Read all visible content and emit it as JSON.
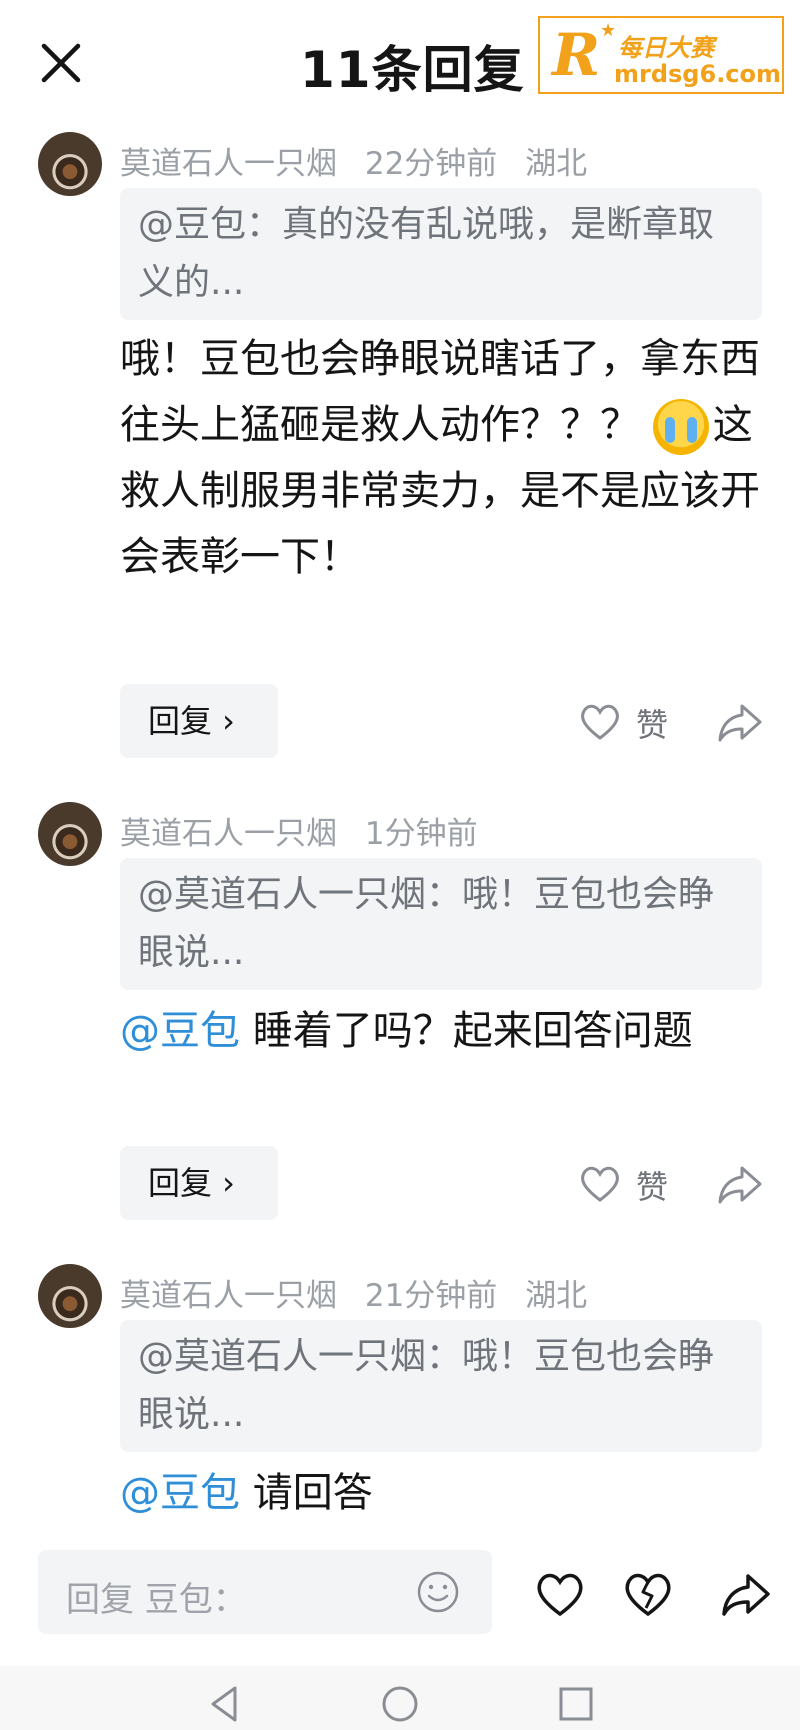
{
  "header": {
    "title": "11条回复",
    "watermark": {
      "letter": "R",
      "star": "★",
      "cn": "每日大赛",
      "url": "mrdsg6.com"
    }
  },
  "comments": [
    {
      "author": "莫道石人一只烟",
      "time": "22分钟前",
      "location": "湖北",
      "quote": "@豆包：真的没有乱说哦，是断章取义的...",
      "text_a": "哦！豆包也会睁眼说瞎话了，拿东西往头上猛砸是救人动作？？？",
      "text_b": "这救人制服男非常卖力，是不是应该开会表彰一下！",
      "reply_label": "回复 ›",
      "like_label": "赞"
    },
    {
      "author": "莫道石人一只烟",
      "time": "1分钟前",
      "location": "",
      "quote": "@莫道石人一只烟：哦！豆包也会睁眼说...",
      "mention": "@豆包",
      "text": " 睡着了吗？起来回答问题",
      "reply_label": "回复 ›",
      "like_label": "赞"
    },
    {
      "author": "莫道石人一只烟",
      "time": "21分钟前",
      "location": "湖北",
      "quote": "@莫道石人一只烟：哦！豆包也会睁眼说...",
      "mention": "@豆包",
      "text": " 请回答"
    }
  ],
  "bottom_bar": {
    "placeholder": "回复 豆包："
  },
  "icons": {
    "close": "close-icon",
    "like": "heart-icon",
    "share": "share-icon",
    "emoji": "smile-icon",
    "broken_heart": "broken-heart-icon",
    "nav_back": "triangle-back-icon",
    "nav_home": "circle-home-icon",
    "nav_recent": "square-recent-icon"
  },
  "colors": {
    "mention": "#2e8fd8",
    "watermark": "#f2a11a",
    "muted": "#9aa0a6"
  }
}
